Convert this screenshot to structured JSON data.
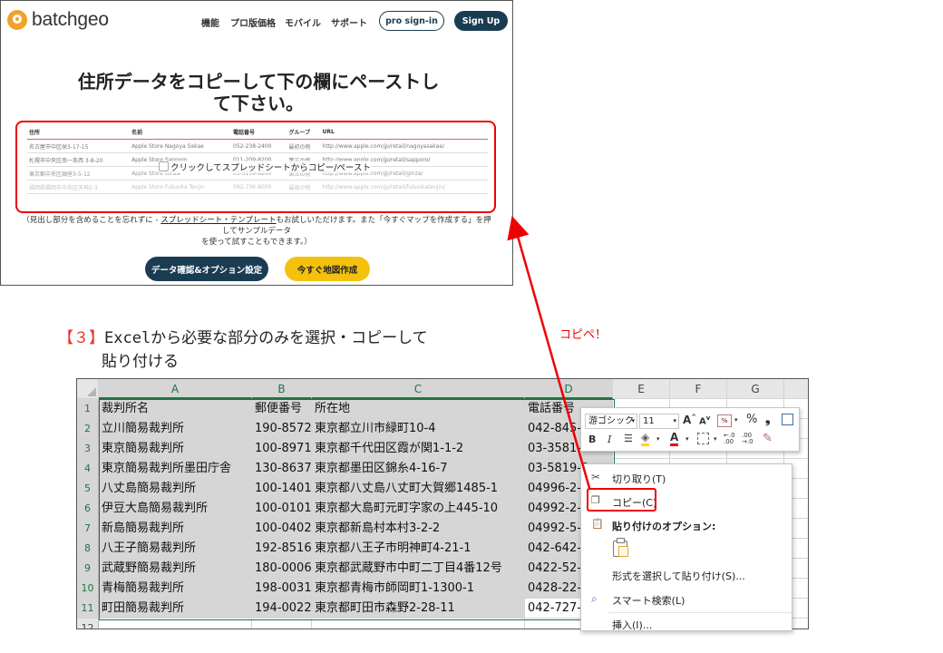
{
  "batchgeo": {
    "logo_text": "batchgeo",
    "nav": [
      "機能",
      "プロ版価格",
      "モバイル",
      "サポート"
    ],
    "pro_signin": "pro sign-in",
    "signup": "Sign Up",
    "heading_line1": "住所データをコピーして下の欄にペーストし",
    "heading_line2": "て下さい。",
    "table_headers": [
      "住所",
      "名前",
      "電話番号",
      "グループ",
      "URL"
    ],
    "table_rows": [
      [
        "名古屋市中区栄3-17-15",
        "Apple Store Nagoya Sakae",
        "052-238-2400",
        "最初の例",
        "http://www.apple.com/jp/retail/nagoyasakae/"
      ],
      [
        "札幌市中央区南一条西 3-8-20",
        "Apple Store Sapporo",
        "011-209-8200",
        "第三の例",
        "http://www.apple.com/jp/retail/sapporo/"
      ],
      [
        "東京都中央区銀座3-5-12",
        "Apple Store Ginza",
        "03-5159-8200",
        "第三の例",
        "http://www.apple.com/jp/retail/ginza/"
      ],
      [
        "福岡県福岡市中央区天神2-3",
        "Apple Store Fukuoka Tenjin",
        "092-736-8000",
        "最後の例",
        "http://www.apple.com/jp/retail/fukuokatenjin/"
      ],
      [
        "",
        "",
        "",
        "",
        ""
      ],
      [
        "",
        "",
        "",
        "",
        ""
      ]
    ],
    "overlay_text": "クリックしてスプレッドシートからコピー/ペースト",
    "note_part1": "（見出し部分を含めることを忘れずに - ",
    "note_link": "スプレッドシート・テンプレート",
    "note_part2": "もお試しいただけます。また「今すぐマップを作成する」を押してサンプルデータ",
    "note_line2": "を使って試すこともできます。）",
    "btn_validate": "データ確認&オプション設定",
    "btn_map": "今すぐ地図作成"
  },
  "caption": {
    "bracket": "【３】",
    "line1": "Excelから必要な部分のみを選択・コピーして",
    "line2": "貼り付ける"
  },
  "annotation": "コピペ！",
  "colors": {
    "accent_red": "#e00000",
    "batchgeo_navy": "#1a3c52",
    "batchgeo_yellow": "#f4c20d",
    "excel_green": "#217346"
  },
  "excel": {
    "columns": [
      "A",
      "B",
      "C",
      "D",
      "E",
      "F",
      "G"
    ],
    "rows": [
      [
        "裁判所名",
        "郵便番号",
        "所在地",
        "電話番号"
      ],
      [
        "立川簡易裁判所",
        "190-8572",
        "東京都立川市緑町10-4",
        "042-845-0"
      ],
      [
        "東京簡易裁判所",
        "100-8971",
        "東京都千代田区霞が関1-1-2",
        "03-3581-5"
      ],
      [
        "東京簡易裁判所墨田庁舎",
        "130-8637",
        "東京都墨田区錦糸4-16-7",
        "03-5819-0"
      ],
      [
        "八丈島簡易裁判所",
        "100-1401",
        "東京都八丈島八丈町大賀郷1485-1",
        "04996-2-0"
      ],
      [
        "伊豆大島簡易裁判所",
        "100-0101",
        "東京都大島町元町字家の上445-10",
        "04992-2-1"
      ],
      [
        "新島簡易裁判所",
        "100-0402",
        "東京都新島村本村3-2-2",
        "04992-5-1"
      ],
      [
        "八王子簡易裁判所",
        "192-8516",
        "東京都八王子市明神町4-21-1",
        "042-642-7"
      ],
      [
        "武蔵野簡易裁判所",
        "180-0006",
        "東京都武蔵野市中町二丁目4番12号",
        "0422-52-2"
      ],
      [
        "青梅簡易裁判所",
        "198-0031",
        "東京都青梅市師岡町1-1300-1",
        "0428-22-2"
      ],
      [
        "町田簡易裁判所",
        "194-0022",
        "東京都町田市森野2-28-11",
        "042-727-5"
      ]
    ],
    "row_numbers": [
      "1",
      "2",
      "3",
      "4",
      "5",
      "6",
      "7",
      "8",
      "9",
      "10",
      "11",
      "12"
    ]
  },
  "mini_toolbar": {
    "font_name": "游ゴシック",
    "font_size": "11",
    "grow": "A",
    "shrink": "A",
    "percent": "%",
    "comma": "❟",
    "bold": "B",
    "italic": "I",
    "font_color": "A",
    "dec_inc": "←.0 .00",
    "dec_dec": ".00 →.0"
  },
  "context_menu": {
    "cut": "切り取り(T)",
    "copy": "コピー(C)",
    "paste_options": "貼り付けのオプション:",
    "paste_special": "形式を選択して貼り付け(S)...",
    "smart_lookup": "スマート検索(L)",
    "insert": "挿入(I)..."
  }
}
